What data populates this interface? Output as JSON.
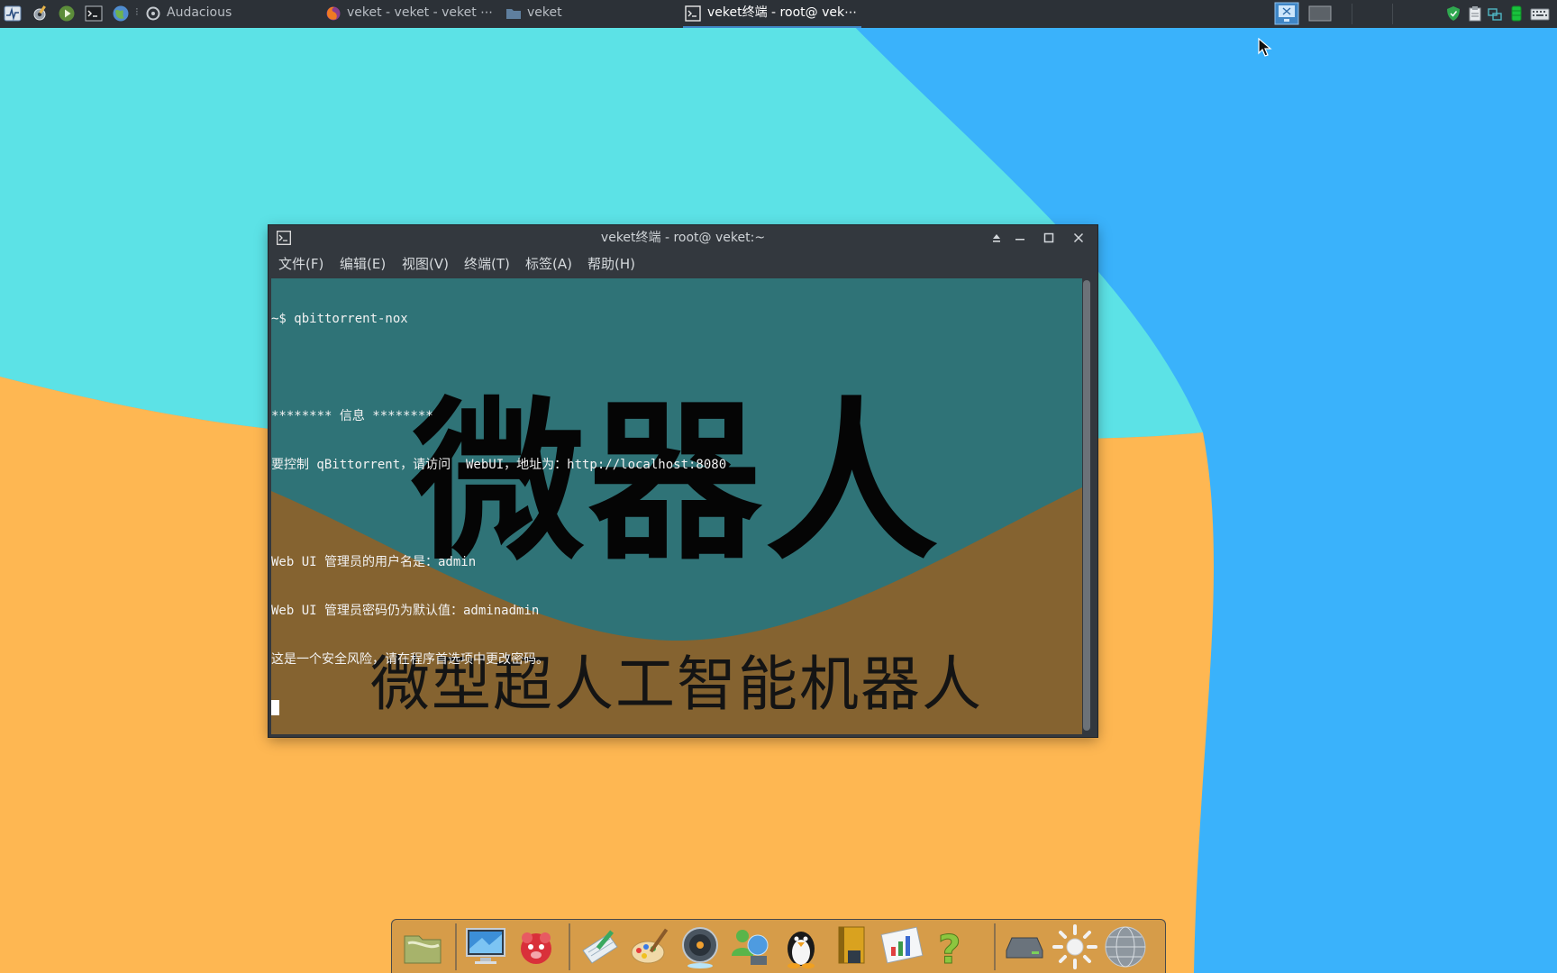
{
  "taskbar": {
    "tasks": [
      {
        "label": "Audacious",
        "icon": "audacious-icon"
      },
      {
        "label": "veket - veket - veket ⋯",
        "icon": "firefox-icon"
      },
      {
        "label": "veket",
        "icon": "folder-icon"
      },
      {
        "label": "veket终端 - root@ vek⋯",
        "icon": "terminal-icon",
        "active": true
      }
    ]
  },
  "terminal": {
    "title": "veket终端 - root@ veket:~",
    "menu": [
      "文件(F)",
      "编辑(E)",
      "视图(V)",
      "终端(T)",
      "标签(A)",
      "帮助(H)"
    ],
    "lines": [
      "~$ qbittorrent-nox",
      "",
      "******** 信息 ********",
      "要控制 qBittorrent，请访问  WebUI，地址为：http://localhost:8080",
      "",
      "Web UI 管理员的用户名是：admin",
      "Web UI 管理员密码仍为默认值：adminadmin",
      "这是一个安全风险，请在程序首选项中更改密码。"
    ],
    "wallpaper_title": "微器人",
    "wallpaper_subtitle": "微型超人工智能机器人"
  },
  "colors": {
    "desktop_cyan": "#5ce2e6",
    "desktop_blue": "#3ab2fb",
    "desktop_orange": "#feb752",
    "terminal_teal": "#2f7377",
    "terminal_brown": "#856330",
    "taskbar": "#2c3137",
    "active_task_underline": "#3f86c6"
  },
  "dock": {
    "icons": [
      "file-manager-icon",
      "monitor-icon",
      "pet-icon",
      "notepad-icon",
      "paint-icon",
      "media-player-icon",
      "users-icon",
      "penguin-icon",
      "book-icon",
      "chart-icon",
      "help-icon",
      "drive-icon",
      "sun-icon",
      "globe-icon"
    ]
  }
}
